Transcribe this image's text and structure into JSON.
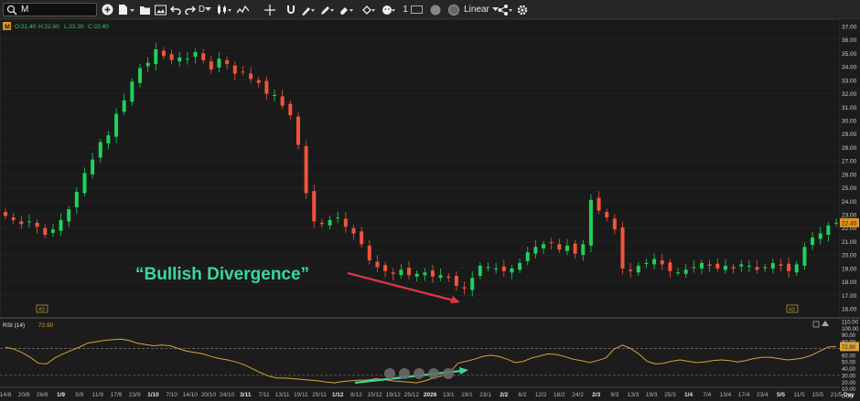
{
  "toolbar": {
    "search_value": "M",
    "timeframe_label": "D",
    "line_width_value": "1",
    "scale_label": "Linear",
    "icons": [
      "search-icon",
      "add-icon",
      "file-icon",
      "folder-icon",
      "save-icon",
      "image-icon",
      "undo-icon",
      "redo-icon",
      "candles-icon",
      "line-chart-icon",
      "crosshair-icon",
      "move-icon",
      "brush-icon",
      "pencil-icon",
      "eraser-icon",
      "fill-icon",
      "emoji-icon",
      "color-swatch-icon",
      "share-icon",
      "gear-icon"
    ]
  },
  "chart_data": [
    {
      "type": "candlestick",
      "symbol_label": "M",
      "ohlc_label": {
        "open": "O:21.40",
        "high": "H:22.60",
        "low": "L:21.30",
        "close": "C:22.40"
      },
      "current_price_label": "22.40",
      "ylim": [
        15.5,
        37.5
      ],
      "yticks": [
        "37.00",
        "36.00",
        "35.00",
        "34.00",
        "33.00",
        "32.00",
        "31.00",
        "30.00",
        "29.00",
        "28.00",
        "27.00",
        "26.00",
        "25.00",
        "24.00",
        "23.00",
        "22.00",
        "21.00",
        "20.00",
        "19.00",
        "18.00",
        "17.00",
        "16.00"
      ],
      "close_path": [
        22.9,
        22.6,
        22.3,
        22.5,
        22.1,
        21.5,
        21.9,
        22.6,
        23.4,
        24.7,
        26.1,
        27.1,
        28.4,
        28.9,
        30.5,
        31.5,
        32.9,
        33.9,
        34.3,
        35.3,
        34.8,
        34.5,
        34.7,
        34.6,
        35.1,
        34.5,
        33.8,
        34.6,
        34.2,
        33.5,
        33.6,
        33.1,
        32.8,
        32.0,
        31.9,
        31.1,
        30.4,
        28.2,
        24.6,
        22.5,
        22.3,
        22.6,
        22.8,
        22.1,
        21.6,
        20.8,
        19.6,
        19.1,
        18.8,
        18.6,
        18.9,
        18.5,
        18.6,
        18.7,
        18.4,
        18.5,
        18.3,
        17.7,
        17.5,
        18.3,
        19.2,
        19.1,
        19.0,
        18.8,
        19.0,
        19.4,
        20.2,
        20.6,
        20.8,
        20.9,
        20.4,
        20.7,
        20.1,
        20.8,
        24.1,
        23.3,
        22.8,
        21.9,
        19.0,
        18.8,
        19.2,
        19.4,
        19.7,
        19.3,
        18.8,
        18.7,
        18.9,
        19.1,
        19.4,
        19.2,
        19.0,
        19.2,
        19.0,
        19.3,
        19.2,
        18.9,
        19.1,
        19.4,
        19.2,
        18.8,
        19.3,
        20.6,
        21.3,
        21.6,
        22.2,
        22.4
      ],
      "annotation_text": "“Bullish Divergence”",
      "corner_label_left": "XD",
      "corner_label_right": "XD"
    },
    {
      "type": "line",
      "indicator_label": "RSI (14)",
      "value_label": "72.90",
      "ylim": [
        0,
        110
      ],
      "yticks": [
        "110.00",
        "100.00",
        "90.00",
        "80.00",
        "70.00",
        "60.00",
        "50.00",
        "40.00",
        "30.00",
        "20.00",
        "10.00",
        "0.00"
      ],
      "reference_lines": [
        70,
        30
      ],
      "current_value_label": "72.90",
      "rsi_path": [
        72,
        69,
        64,
        57,
        48,
        47,
        56,
        62,
        67,
        72,
        78,
        80,
        82,
        83,
        84,
        82,
        78,
        76,
        74,
        75,
        74,
        70,
        66,
        64,
        62,
        58,
        55,
        53,
        50,
        46,
        40,
        34,
        29,
        26,
        26,
        25,
        24,
        23,
        22,
        20,
        19,
        21,
        22,
        23,
        23,
        25,
        24,
        22,
        21,
        20,
        19,
        22,
        26,
        29,
        34,
        48,
        51,
        54,
        58,
        60,
        58,
        54,
        49,
        51,
        56,
        59,
        62,
        61,
        58,
        54,
        52,
        49,
        52,
        56,
        69,
        75,
        70,
        62,
        51,
        47,
        48,
        51,
        53,
        51,
        49,
        50,
        52,
        53,
        52,
        50,
        52,
        55,
        57,
        57,
        55,
        53,
        54,
        56,
        60,
        66,
        72,
        73
      ]
    }
  ],
  "x_axis": {
    "labels": [
      "14/8",
      "20/8",
      "26/8",
      "1/9",
      "5/9",
      "11/9",
      "17/9",
      "23/9",
      "1/10",
      "7/10",
      "14/10",
      "20/10",
      "24/10",
      "3/11",
      "7/11",
      "13/11",
      "19/11",
      "25/11",
      "1/12",
      "8/12",
      "15/12",
      "19/12",
      "25/12",
      "2026",
      "13/1",
      "19/1",
      "23/1",
      "2/2",
      "6/2",
      "12/2",
      "18/2",
      "24/2",
      "2/3",
      "9/3",
      "13/3",
      "19/3",
      "25/3",
      "1/4",
      "7/4",
      "13/4",
      "17/4",
      "23/4",
      "5/5",
      "11/5",
      "15/5",
      "21/5"
    ],
    "bold_labels": [
      "1/9",
      "1/10",
      "3/11",
      "1/12",
      "2026",
      "2/2",
      "2/3",
      "1/4",
      "5/5"
    ],
    "interval_label": "Day"
  }
}
